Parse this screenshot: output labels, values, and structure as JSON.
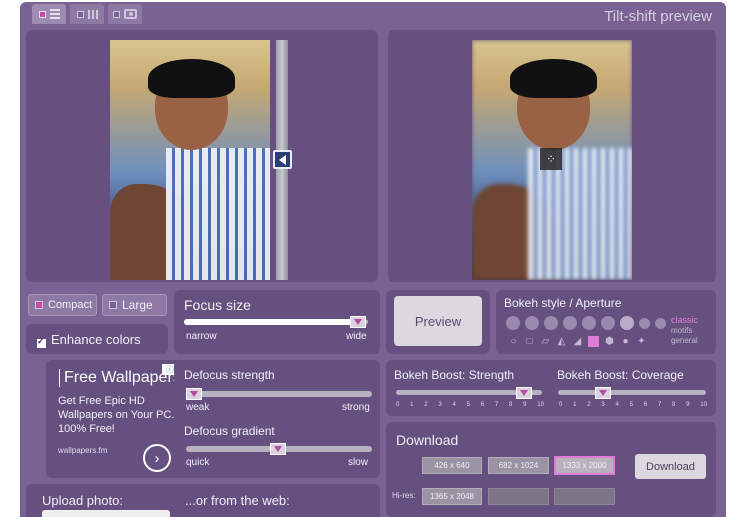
{
  "header": {
    "title": "Tilt-shift preview",
    "tabs": [
      {
        "name": "tab-list-view",
        "icon": "list-icon",
        "active": true
      },
      {
        "name": "tab-columns-view",
        "icon": "columns-icon",
        "active": false
      },
      {
        "name": "tab-camera",
        "icon": "camera-icon",
        "active": false
      }
    ]
  },
  "mode": {
    "compact_label": "Compact",
    "large_label": "Large",
    "enhance_label": "Enhance colors",
    "enhance_checked": true
  },
  "focus_size": {
    "title": "Focus size",
    "min_label": "narrow",
    "max_label": "wide",
    "value_pct": 100
  },
  "preview_button": "Preview",
  "bokeh_style": {
    "title": "Bokeh style / Aperture",
    "sets": [
      "classic",
      "motifs",
      "general"
    ]
  },
  "defocus_strength": {
    "title": "Defocus strength",
    "min_label": "weak",
    "max_label": "strong",
    "value_pct": 5
  },
  "defocus_gradient": {
    "title": "Defocus gradient",
    "min_label": "quick",
    "max_label": "slow",
    "value_pct": 50
  },
  "bokeh_boost_strength": {
    "title": "Bokeh Boost: Strength",
    "ticks": [
      "0",
      "1",
      "2",
      "3",
      "4",
      "5",
      "6",
      "7",
      "8",
      "9",
      "10"
    ],
    "value": 9
  },
  "bokeh_boost_coverage": {
    "title": "Bokeh Boost: Coverage",
    "ticks": [
      "0",
      "1",
      "2",
      "3",
      "4",
      "5",
      "6",
      "7",
      "8",
      "9",
      "10"
    ],
    "value": 3
  },
  "download": {
    "title": "Download",
    "sizes": [
      "426 x 640",
      "682 x 1024",
      "1333 x 2000"
    ],
    "selected": "1333 x 2000",
    "hires_label": "Hi-res:",
    "hires_sizes": [
      "1365 x 2048"
    ],
    "button": "Download"
  },
  "ad": {
    "title": "Free Wallpapers",
    "body": "Get Free Epic HD Wallpapers on Your PC. 100% Free!",
    "url": "wallpapers.fm"
  },
  "upload": {
    "label": "Upload photo:",
    "web_label": "...or from the web:"
  },
  "colors": {
    "background": "#7a6393",
    "panel": "#66507f",
    "accent": "#c84aa6"
  }
}
